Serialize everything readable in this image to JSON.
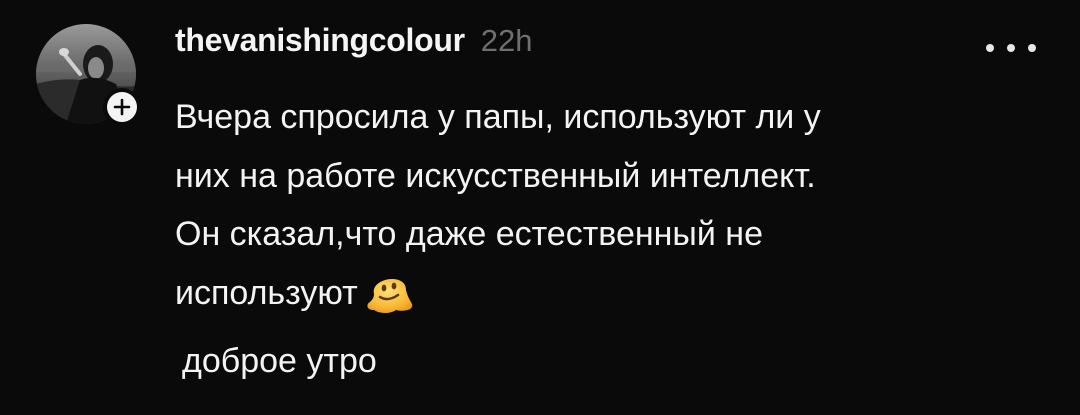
{
  "post": {
    "username": "thevanishingcolour",
    "timestamp": "22h",
    "body_lines": [
      "Вчера спросила у папы, используют ли у",
      "них на работе искусственный интеллект.",
      "Он сказал,что даже естественный не",
      "используют"
    ],
    "emoji": "melting-face-emoji",
    "footer_text": "доброе утро"
  },
  "icons": {
    "avatar": "profile-photo",
    "follow": "plus-icon",
    "more": "more-dots-icon"
  },
  "colors": {
    "background": "#0a0a0a",
    "text": "#f3f3f3",
    "muted": "#6f6f6f"
  }
}
